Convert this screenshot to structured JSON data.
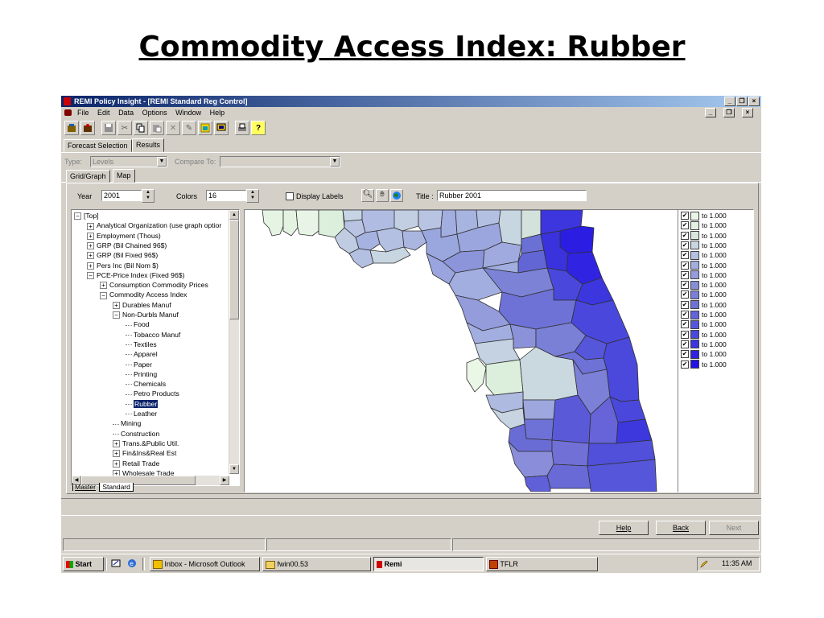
{
  "slide": {
    "title": "Commodity Access Index: Rubber"
  },
  "window": {
    "title": "REMI Policy Insight - [REMI Standard Reg Control]",
    "controls": [
      "_",
      "❐",
      "×"
    ]
  },
  "menu": [
    "File",
    "Edit",
    "Data",
    "Options",
    "Window",
    "Help"
  ],
  "toolbar_icons": [
    "open-icon",
    "close-file-icon",
    "save-icon",
    "cut-icon",
    "copy-icon",
    "paste-icon",
    "delete-icon",
    "wizard-icon",
    "table-icon",
    "monitor-icon",
    "print-icon",
    "help-icon"
  ],
  "tabs": {
    "forecast": "Forecast Selection",
    "results": "Results",
    "grid_graph": "Grid/Graph",
    "map": "Map"
  },
  "type_row": {
    "type_label": "Type:",
    "type_value": "Levels",
    "compare_label": "Compare To:",
    "compare_value": ""
  },
  "controls": {
    "year_label": "Year",
    "year_value": "2001",
    "colors_label": "Colors",
    "colors_value": "16",
    "display_labels": "Display Labels",
    "title_label": "Title :",
    "title_value": "Rubber  2001"
  },
  "tree": [
    {
      "indent": 0,
      "exp": "−",
      "label": "[Top]"
    },
    {
      "indent": 1,
      "exp": "+",
      "label": "Analytical Organization (use graph optior"
    },
    {
      "indent": 1,
      "exp": "+",
      "label": "Employment (Thous)"
    },
    {
      "indent": 1,
      "exp": "+",
      "label": "GRP (Bil Chained 96$)"
    },
    {
      "indent": 1,
      "exp": "+",
      "label": "GRP (Bil Fixed 96$)"
    },
    {
      "indent": 1,
      "exp": "+",
      "label": "Pers Inc (Bil Nom $)"
    },
    {
      "indent": 1,
      "exp": "−",
      "label": "PCE-Price Index (Fixed 96$)"
    },
    {
      "indent": 2,
      "exp": "+",
      "label": "Consumption Commodity Prices"
    },
    {
      "indent": 2,
      "exp": "−",
      "label": "Commodity Access Index"
    },
    {
      "indent": 3,
      "exp": "+",
      "label": "Durables Manuf"
    },
    {
      "indent": 3,
      "exp": "−",
      "label": "Non-Durbls Manuf"
    },
    {
      "indent": 4,
      "exp": "",
      "label": "Food"
    },
    {
      "indent": 4,
      "exp": "",
      "label": "Tobacco Manuf"
    },
    {
      "indent": 4,
      "exp": "",
      "label": "Textiles"
    },
    {
      "indent": 4,
      "exp": "",
      "label": "Apparel"
    },
    {
      "indent": 4,
      "exp": "",
      "label": "Paper"
    },
    {
      "indent": 4,
      "exp": "",
      "label": "Printing"
    },
    {
      "indent": 4,
      "exp": "",
      "label": "Chemicals"
    },
    {
      "indent": 4,
      "exp": "",
      "label": "Petro Products"
    },
    {
      "indent": 4,
      "exp": "",
      "label": "Rubber",
      "selected": true
    },
    {
      "indent": 4,
      "exp": "",
      "label": "Leather"
    },
    {
      "indent": 3,
      "exp": "",
      "label": "Mining"
    },
    {
      "indent": 3,
      "exp": "",
      "label": "Construction"
    },
    {
      "indent": 3,
      "exp": "+",
      "label": "Trans.&Public Util."
    },
    {
      "indent": 3,
      "exp": "+",
      "label": "Fin&Ins&Real Est"
    },
    {
      "indent": 3,
      "exp": "+",
      "label": "Retail Trade"
    },
    {
      "indent": 3,
      "exp": "+",
      "label": "Wholesale Trade"
    }
  ],
  "tree_tabs": [
    "Master",
    "Standard"
  ],
  "legend": [
    {
      "label": "to 1.000",
      "color": "#eaf6e6"
    },
    {
      "label": "to 1.000",
      "color": "#e4f1e2"
    },
    {
      "label": "to 1.000",
      "color": "#d8e6dc"
    },
    {
      "label": "to 1.000",
      "color": "#c8d6e2"
    },
    {
      "label": "to 1.000",
      "color": "#b4c0e2"
    },
    {
      "label": "to 1.000",
      "color": "#a2aee0"
    },
    {
      "label": "to 1.000",
      "color": "#949cdc"
    },
    {
      "label": "to 1.000",
      "color": "#868ed8"
    },
    {
      "label": "to 1.000",
      "color": "#7a80d6"
    },
    {
      "label": "to 1.000",
      "color": "#6e72d6"
    },
    {
      "label": "to 1.000",
      "color": "#6264d8"
    },
    {
      "label": "to 1.000",
      "color": "#5656da"
    },
    {
      "label": "to 1.000",
      "color": "#4a48dc"
    },
    {
      "label": "to 1.000",
      "color": "#3c36de"
    },
    {
      "label": "to 1.000",
      "color": "#3024e2"
    },
    {
      "label": "to 1.000",
      "color": "#2212e6"
    }
  ],
  "nav_buttons": {
    "help": "Help",
    "back": "Back",
    "next": "Next"
  },
  "taskbar": {
    "start": "Start",
    "tasks": [
      "Inbox - Microsoft Outlook",
      "fwin00.53",
      "Remi",
      "TFLR"
    ],
    "clock": "11:35 AM"
  }
}
